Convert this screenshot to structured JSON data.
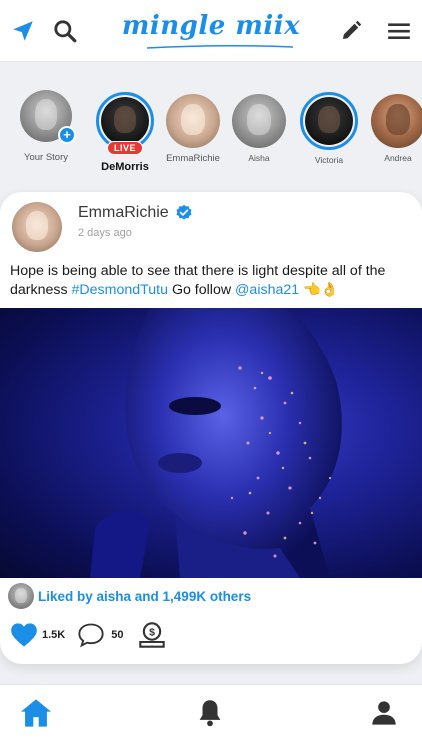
{
  "app": {
    "logo": "mingle miix"
  },
  "header": {
    "icons": [
      "navigation-arrow-icon",
      "search-icon",
      "edit-pencil-icon",
      "menu-icon"
    ]
  },
  "colors": {
    "accent": "#1b8ee8",
    "live": "#e53935",
    "photo_bg": "#1e2399"
  },
  "stories": [
    {
      "name": "Your Story",
      "badge": "+"
    },
    {
      "name": "DeMorris",
      "badge": "LIVE"
    },
    {
      "name": "EmmaRichie"
    },
    {
      "name": "Aisha"
    },
    {
      "name": "Victoria"
    },
    {
      "name": "Andrea"
    }
  ],
  "post": {
    "author": "EmmaRichie",
    "time": "2 days ago",
    "caption_text_1": "Hope is being able to see that there is light despite all of the darkness ",
    "caption_hashtag": "#DesmondTutu",
    "caption_text_2": " Go follow ",
    "caption_mention": "@aisha21",
    "caption_emoji": " 👈👌",
    "liked_text": "Liked by aisha and 1,499K others",
    "likes": "1.5K",
    "comments": "50"
  },
  "bottom_nav": [
    "home-icon",
    "notifications-bell-icon",
    "profile-icon"
  ]
}
